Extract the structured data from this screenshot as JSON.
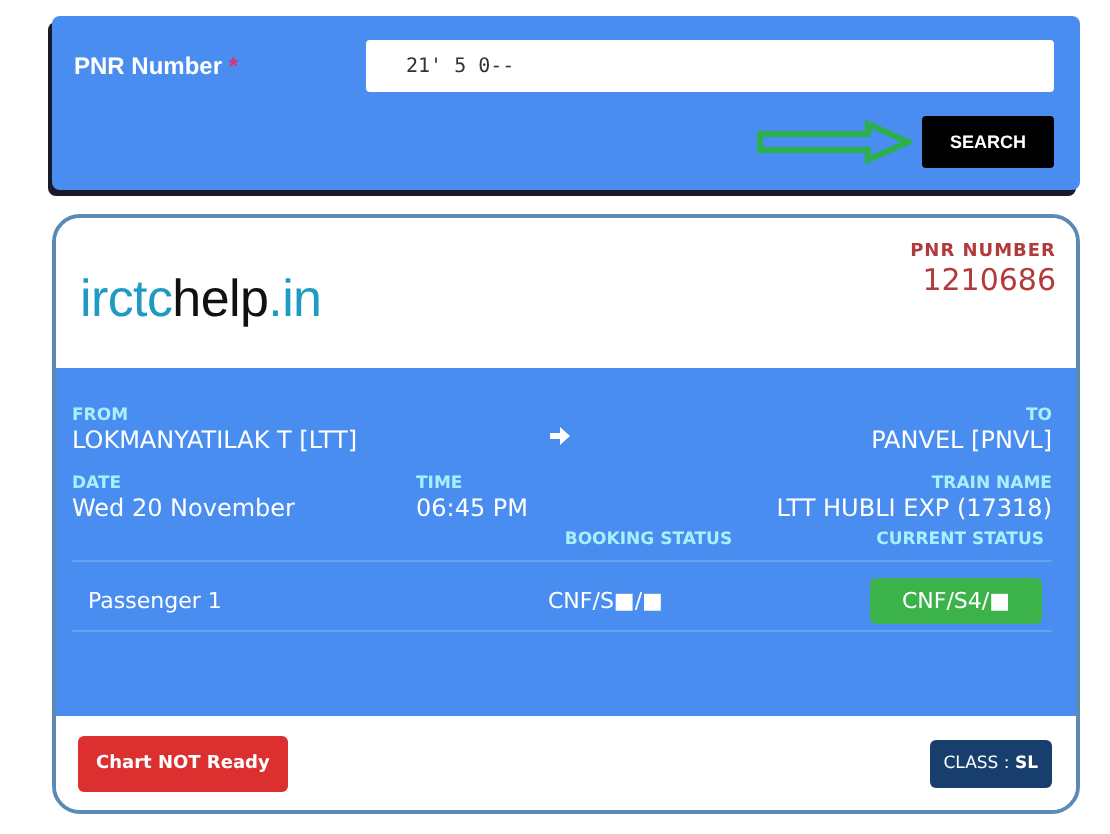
{
  "search_form": {
    "label": "PNR Number",
    "required_mark": "*",
    "value": "21' 5 0--",
    "button": "SEARCH"
  },
  "ticket": {
    "logo": {
      "part1": "irctc",
      "part2": "help",
      "part3": ".in"
    },
    "pnr_label": "PNR NUMBER",
    "pnr_value": "1210686",
    "from_label": "FROM",
    "from_value": "LOKMANYATILAK T [LTT]",
    "to_label": "TO",
    "to_value": "PANVEL [PNVL]",
    "date_label": "DATE",
    "date_value": "Wed 20 November",
    "time_label": "TIME",
    "time_value": "06:45 PM",
    "train_label": "TRAIN NAME",
    "train_value": "LTT HUBLI EXP (17318)",
    "booking_status_label": "BOOKING STATUS",
    "current_status_label": "CURRENT STATUS",
    "passengers": [
      {
        "name": "Passenger 1",
        "booking_status": "CNF/S■/■",
        "current_status": "CNF/S4/■"
      }
    ],
    "chart_status": "Chart NOT Ready",
    "class_badge": "CLASS : **SL**"
  }
}
